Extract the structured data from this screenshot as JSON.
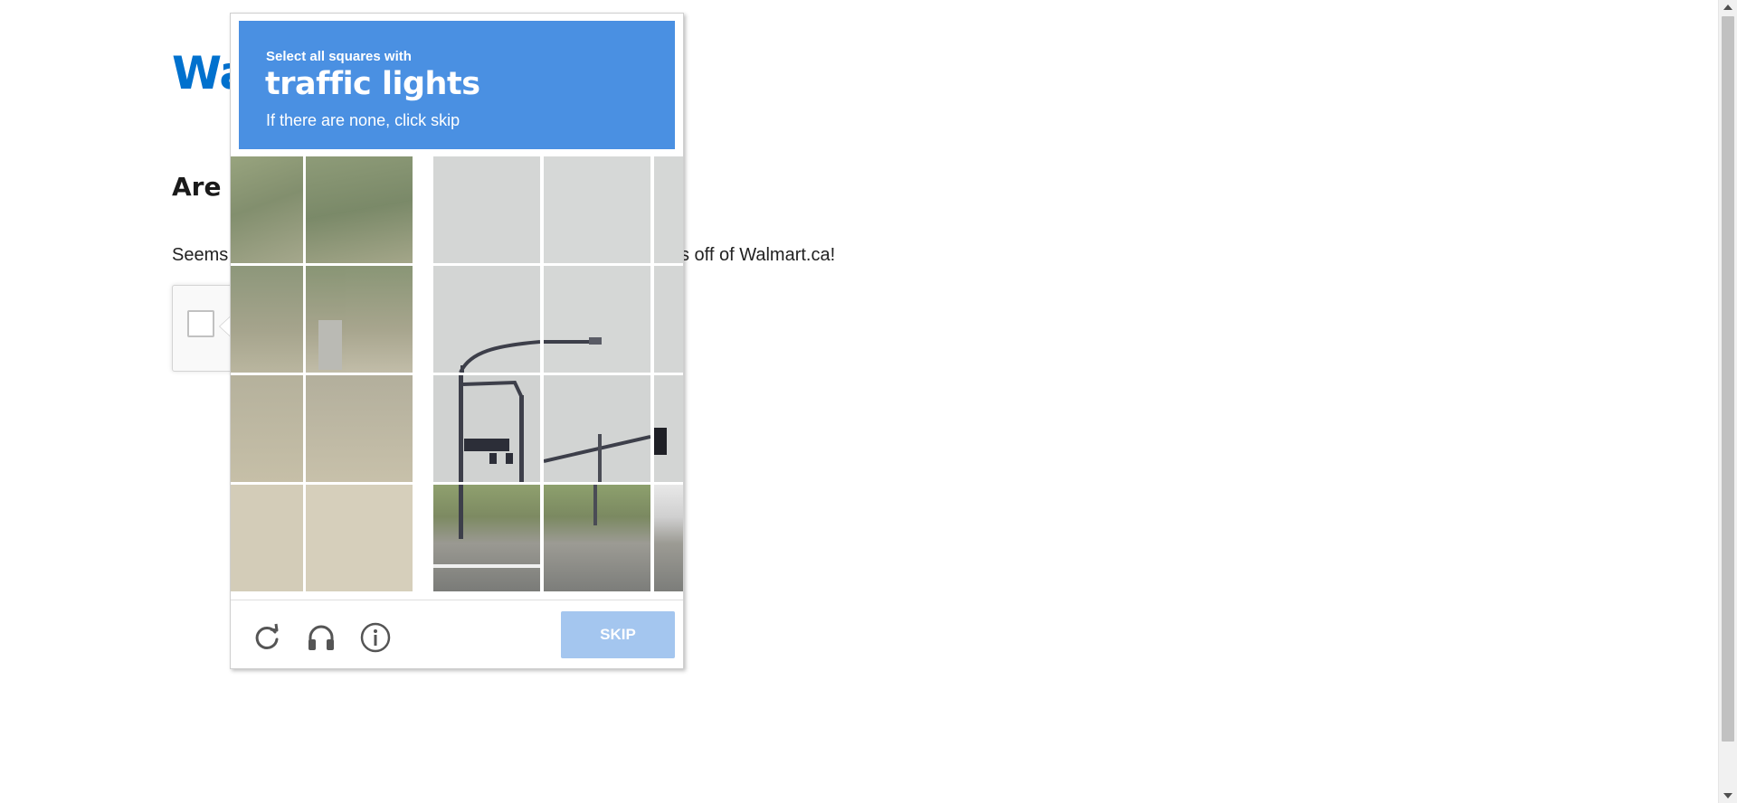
{
  "page": {
    "logo_text": "Wa",
    "heading": "Are y",
    "body_prefix": "Seems",
    "body_suffix": "s off of Walmart.ca!"
  },
  "captcha": {
    "instruction_small": "Select all squares with",
    "target": "traffic lights",
    "instruction_sub": "If there are none, click skip",
    "skip_label": "SKIP",
    "colors": {
      "header": "#4a90e2",
      "skip_button": "#a4c6ef"
    },
    "footer_icons": [
      "reload-icon",
      "audio-icon",
      "info-icon"
    ]
  }
}
